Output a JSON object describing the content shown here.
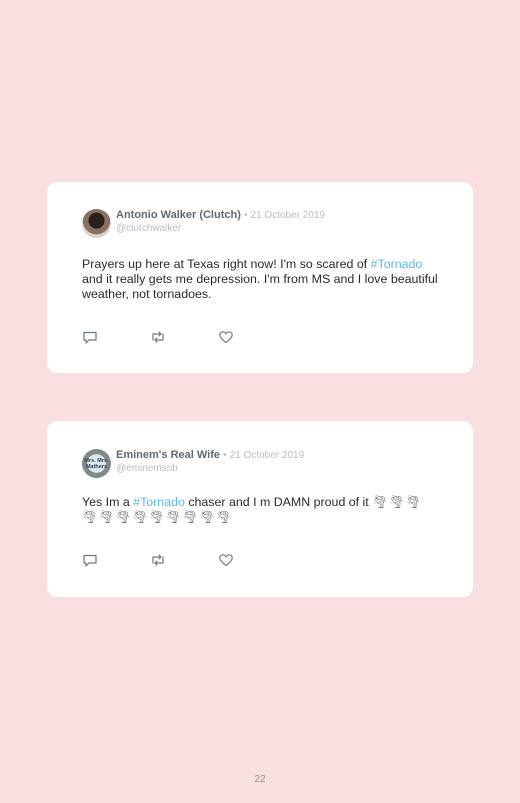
{
  "tweets": [
    {
      "name": "Antonio Walker (Clutch)",
      "separator": "•",
      "date": "21 October 2019",
      "handle": "@clutchwalker",
      "text_before": "Prayers up here at Texas right now! I'm so scared of ",
      "hashtag": "#Tornado",
      "text_after": " and it really gets me depression. I'm from MS and I love beautiful weather, not tornadoes.",
      "emoji": ""
    },
    {
      "name": "Eminem's Real Wife",
      "separator": "•",
      "date": "21 October 2019",
      "handle": "@eminemsrib",
      "avatar_text": "Mrs. Mrs. Mathers",
      "text_before": "Yes Im a ",
      "hashtag": "#Tornado",
      "text_after": " chaser and I m DAMN proud of it ",
      "emoji": "🌪🌪🌪 🌪🌪🌪🌪🌪🌪🌪🌪🌪"
    }
  ],
  "action_icons": [
    "reply-icon",
    "retweet-icon",
    "like-icon"
  ],
  "colors": {
    "background": "#f9dfdf",
    "card": "#ffffff",
    "hashtag": "#5fb7e5",
    "name": "#5d6a75",
    "muted": "#b6bcc2"
  },
  "page_number": "22"
}
